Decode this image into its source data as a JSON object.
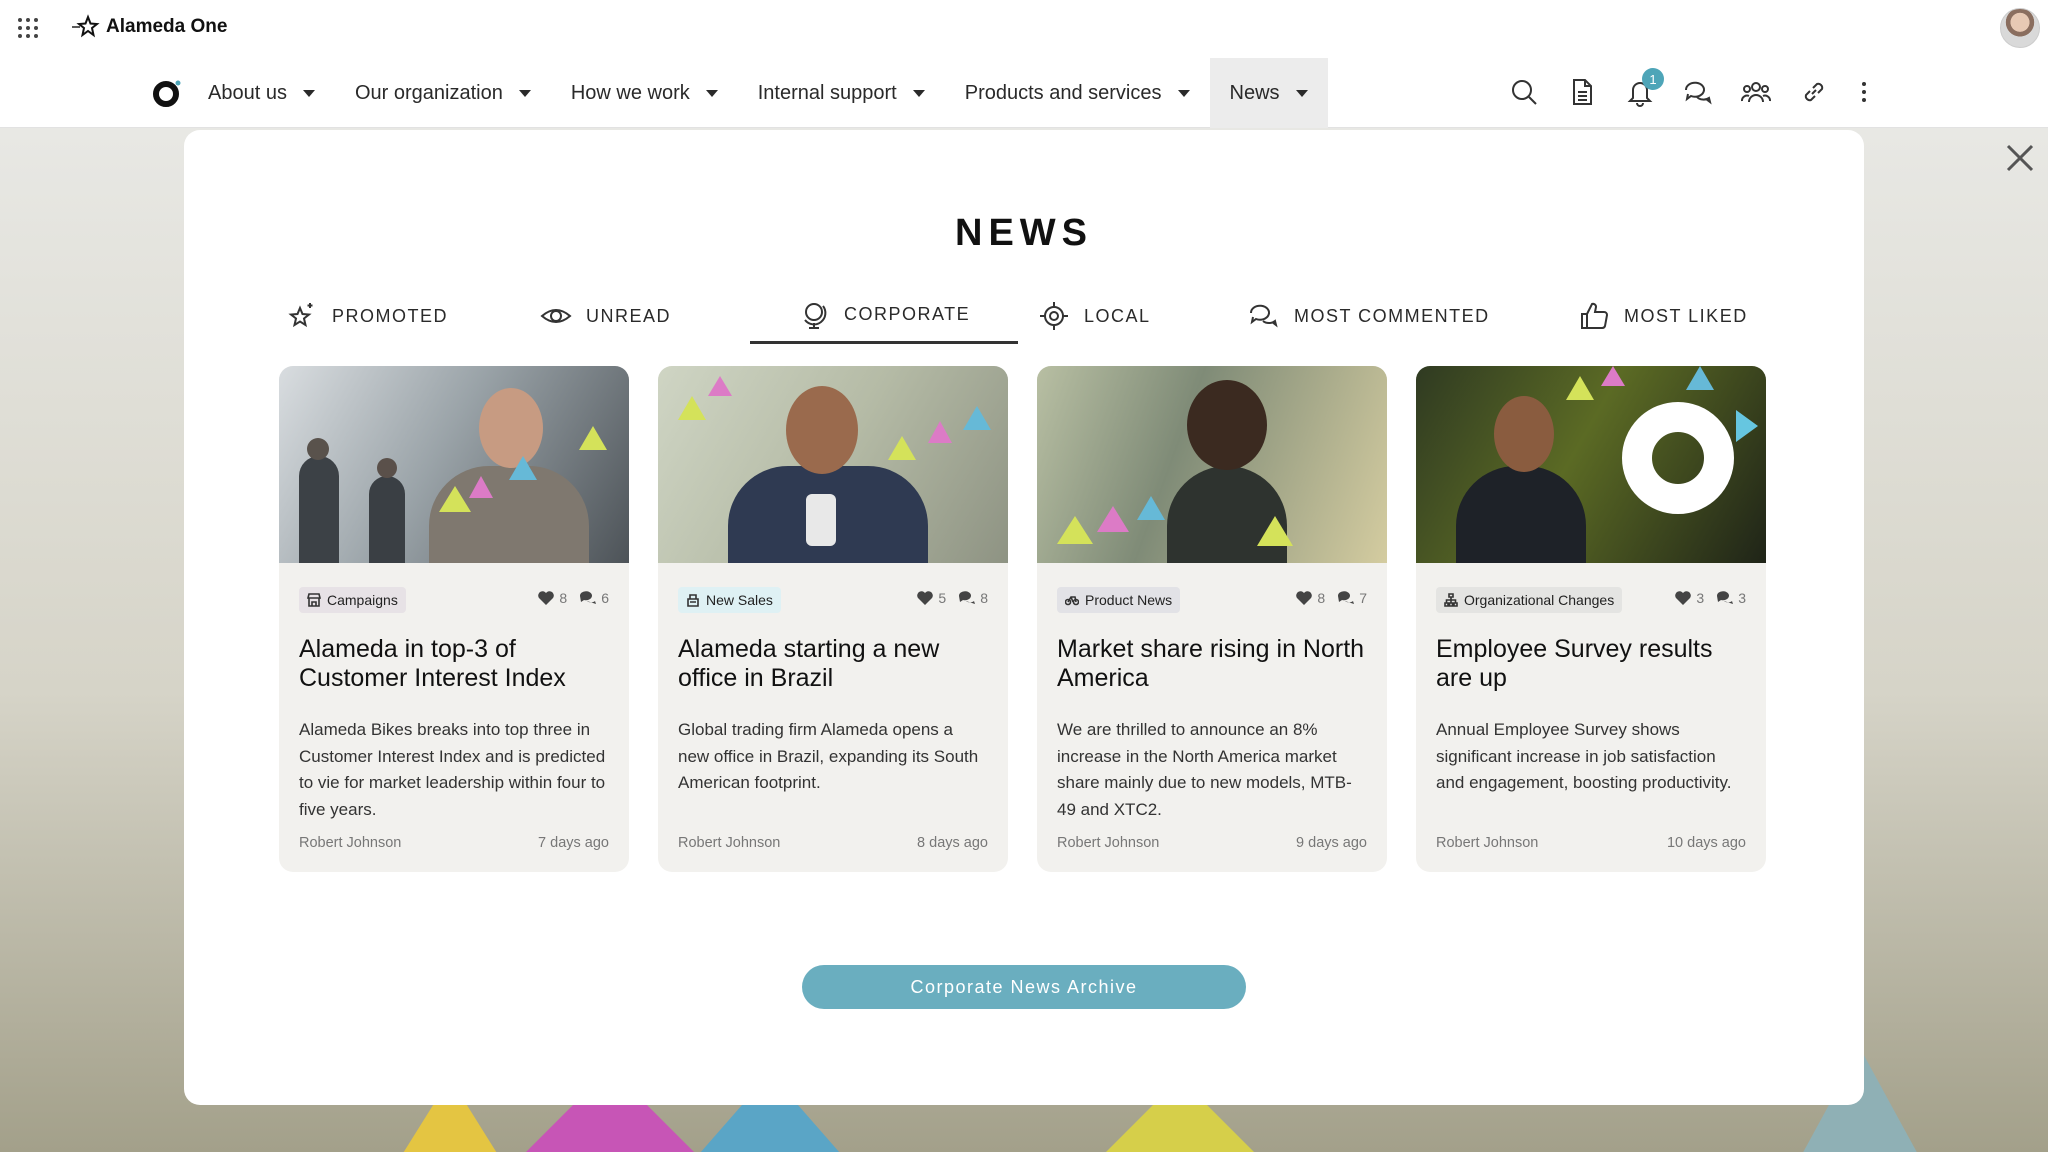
{
  "app": {
    "name": "Alameda One"
  },
  "nav": {
    "items": [
      {
        "label": "About us"
      },
      {
        "label": "Our organization"
      },
      {
        "label": "How we work"
      },
      {
        "label": "Internal support"
      },
      {
        "label": "Products and services"
      },
      {
        "label": "News"
      }
    ],
    "active": "News",
    "notification_count": "1",
    "tools": [
      "search-icon",
      "document-icon",
      "bell-icon",
      "chat-icon",
      "people-icon",
      "link-icon",
      "more-icon"
    ]
  },
  "news": {
    "title": "NEWS",
    "tabs": [
      {
        "label": "PROMOTED",
        "icon": "star-sparkle-icon"
      },
      {
        "label": "UNREAD",
        "icon": "eye-icon"
      },
      {
        "label": "CORPORATE",
        "icon": "globe-icon"
      },
      {
        "label": "LOCAL",
        "icon": "target-icon"
      },
      {
        "label": "MOST COMMENTED",
        "icon": "comments-icon"
      },
      {
        "label": "MOST LIKED",
        "icon": "thumbs-up-icon"
      }
    ],
    "active_tab": "CORPORATE",
    "cards": [
      {
        "tag": "Campaigns",
        "tag_icon": "store-icon",
        "tag_color": "#e7e2e6",
        "likes": "8",
        "comments": "6",
        "title": "Alameda in top-3 of Customer Interest Index",
        "description": "Alameda Bikes breaks into top three in Customer Interest Index and is predicted to vie for market leadership within four to five years.",
        "author": "Robert Johnson",
        "age": "7 days ago"
      },
      {
        "tag": "New Sales",
        "tag_icon": "cash-register-icon",
        "tag_color": "#dff1f4",
        "likes": "5",
        "comments": "8",
        "title": "Alameda starting a new office in Brazil",
        "description": "Global trading firm Alameda opens a new office in Brazil, expanding its South American footprint.",
        "author": "Robert Johnson",
        "age": "8 days ago"
      },
      {
        "tag": "Product News",
        "tag_icon": "bike-icon",
        "tag_color": "#e2e2e6",
        "likes": "8",
        "comments": "7",
        "title": "Market share rising in North America",
        "description": "We are thrilled to announce an 8% increase in the North America market share mainly due to new models, MTB-49 and XTC2.",
        "author": "Robert Johnson",
        "age": "9 days ago"
      },
      {
        "tag": "Organizational Changes",
        "tag_icon": "org-chart-icon",
        "tag_color": "#e4e4e2",
        "likes": "3",
        "comments": "3",
        "title": "Employee Survey results are up",
        "description": "Annual Employee Survey shows significant increase in job satisfaction and engagement, boosting productivity.",
        "author": "Robert Johnson",
        "age": "10 days ago"
      }
    ],
    "archive_button": "Corporate News Archive"
  },
  "colors": {
    "accent": "#6aaebf",
    "badge": "#4ea5b8"
  }
}
